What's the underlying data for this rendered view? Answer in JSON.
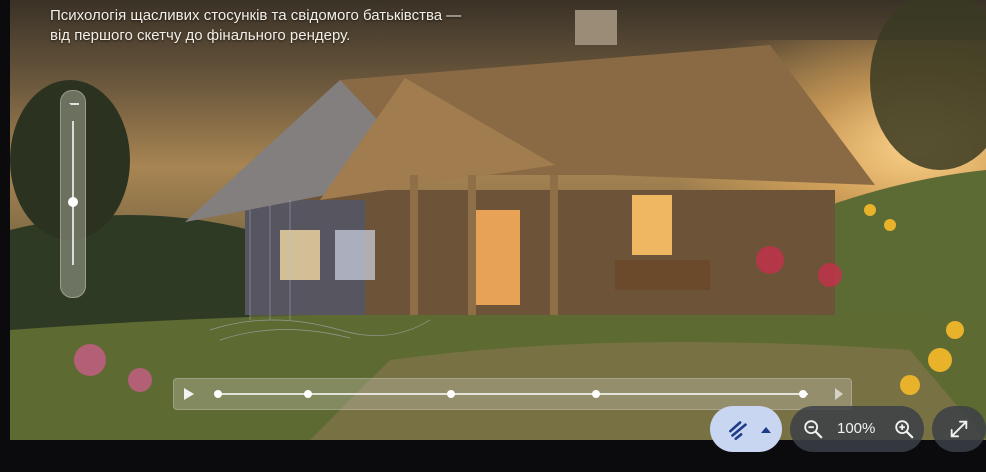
{
  "caption": {
    "line1": "Психологія щасливих стосунків та свідомого батьківства —",
    "line2": "від першого скетчу до фінального рендеру."
  },
  "viewer": {
    "image_alt": "Traditional Ukrainian thatched-roof cottage at sunset with sketch-to-render wireframe overlay",
    "zoom_level": "100%",
    "zoom_slider_value": 0.5,
    "timeline_markers": 5
  },
  "icons": {
    "play": "play-icon",
    "tool": "draw-tool-icon",
    "dropdown": "chevron-up-icon",
    "zoom_out": "zoom-out-icon",
    "zoom_in": "zoom-in-icon",
    "expand": "expand-icon"
  },
  "colors": {
    "tool_active_bg": "#c9d6f2",
    "toolbar_bg": "#3c4048",
    "tool_icon": "#1f3c88"
  }
}
